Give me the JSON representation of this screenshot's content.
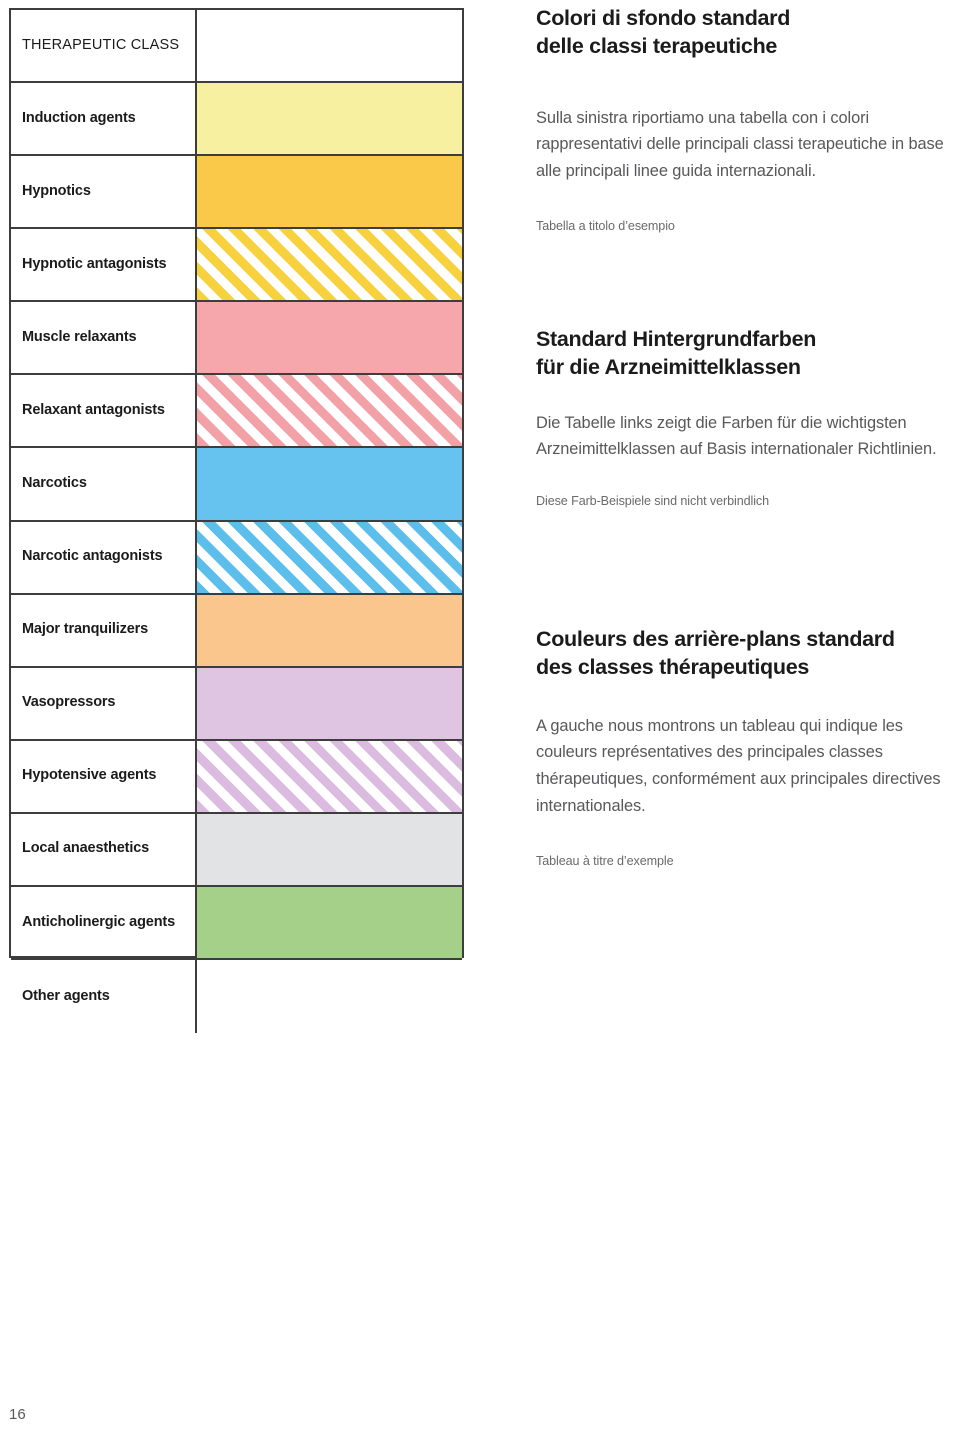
{
  "table": {
    "header_label": "THERAPEUTIC CLASS",
    "rows": [
      {
        "label": "THERAPEUTIC CLASS",
        "swatch": "none",
        "color": "#ffffff",
        "header": true
      },
      {
        "label": "Induction agents",
        "swatch": "solid",
        "color": "#F7F0A0"
      },
      {
        "label": "Hypnotics",
        "swatch": "solid",
        "color": "#FBC94A"
      },
      {
        "label": "Hypnotic antagonists",
        "swatch": "stripe",
        "color": "#F7D23E"
      },
      {
        "label": "Muscle relaxants",
        "swatch": "solid",
        "color": "#F6A7AC"
      },
      {
        "label": "Relaxant antagonists",
        "swatch": "stripe",
        "color": "#F2A2A7"
      },
      {
        "label": "Narcotics",
        "swatch": "solid",
        "color": "#66C2EE"
      },
      {
        "label": "Narcotic antagonists",
        "swatch": "stripe",
        "color": "#5CBEEB"
      },
      {
        "label": "Major tranquilizers",
        "swatch": "solid",
        "color": "#FAC68E"
      },
      {
        "label": "Vasopressors",
        "swatch": "solid",
        "color": "#E0C5E3"
      },
      {
        "label": "Hypotensive agents",
        "swatch": "stripe",
        "color": "#DCBBE0"
      },
      {
        "label": "Local anaesthetics",
        "swatch": "solid",
        "color": "#E2E3E5"
      },
      {
        "label": "Anticholinergic agents",
        "swatch": "solid",
        "color": "#A5D08A"
      },
      {
        "label": "Other agents",
        "swatch": "none",
        "color": "#ffffff"
      }
    ]
  },
  "blocks": {
    "it": {
      "title_line1": "Colori di sfondo standard",
      "title_line2": "delle classi terapeutiche",
      "body": "Sulla sinistra riportiamo una tabella con i colori rappresentativi delle principali classi terapeutiche in base alle principali linee guida internazionali.",
      "caption": "Tabella a titolo d’esempio"
    },
    "de": {
      "title_line1": "Standard Hintergrundfarben",
      "title_line2": "für die Arzneimittelklassen",
      "body": "Die Tabelle links zeigt die Farben für die wichtigsten Arzneimittelklassen auf Basis internationaler Richtlinien.",
      "caption": "Diese Farb-Beispiele sind nicht verbindlich"
    },
    "fr": {
      "title_line1": "Couleurs des arrière-plans standard",
      "title_line2": "des classes thérapeutiques",
      "body": "A gauche nous montrons un  tableau qui indique les couleurs représentatives des principales classes thérapeutiques, conformément aux principales directives internationales.",
      "caption": "Tableau à titre d’exemple"
    }
  },
  "footer": {
    "page_number": "16"
  }
}
